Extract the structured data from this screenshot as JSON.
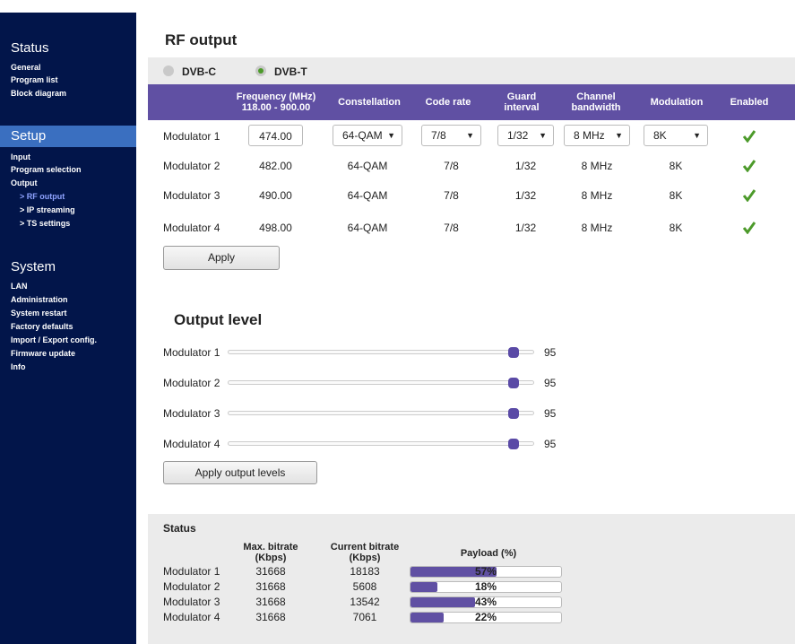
{
  "sidebar": {
    "sections": [
      {
        "title": "Status",
        "items": [
          "General",
          "Program list",
          "Block diagram"
        ]
      },
      {
        "title": "Setup",
        "items": [
          "Input",
          "Program selection",
          "Output"
        ],
        "subitems": [
          "> RF output",
          "> IP streaming",
          "> TS settings"
        ]
      },
      {
        "title": "System",
        "items": [
          "LAN",
          "Administration",
          "System restart",
          "Factory defaults",
          "Import / Export config.",
          "Firmware update",
          "Info"
        ]
      }
    ]
  },
  "rf": {
    "title": "RF output",
    "standards": [
      "DVB-C",
      "DVB-T"
    ],
    "selected_standard": "DVB-T",
    "headers": {
      "frequency": "Frequency (MHz)",
      "frequency_range": "118.00 - 900.00",
      "constellation": "Constellation",
      "code_rate": "Code rate",
      "guard": "Guard interval",
      "guard_l1": "Guard",
      "guard_l2": "interval",
      "bandwidth_l1": "Channel",
      "bandwidth_l2": "bandwidth",
      "modulation": "Modulation",
      "enabled": "Enabled"
    },
    "rows": [
      {
        "name": "Modulator 1",
        "frequency": "474.00",
        "constellation": "64-QAM",
        "code_rate": "7/8",
        "guard": "1/32",
        "bandwidth": "8 MHz",
        "modulation": "8K",
        "enabled": true
      },
      {
        "name": "Modulator 2",
        "frequency": "482.00",
        "constellation": "64-QAM",
        "code_rate": "7/8",
        "guard": "1/32",
        "bandwidth": "8 MHz",
        "modulation": "8K",
        "enabled": true
      },
      {
        "name": "Modulator 3",
        "frequency": "490.00",
        "constellation": "64-QAM",
        "code_rate": "7/8",
        "guard": "1/32",
        "bandwidth": "8 MHz",
        "modulation": "8K",
        "enabled": true
      },
      {
        "name": "Modulator 4",
        "frequency": "498.00",
        "constellation": "64-QAM",
        "code_rate": "7/8",
        "guard": "1/32",
        "bandwidth": "8 MHz",
        "modulation": "8K",
        "enabled": true
      }
    ],
    "apply_label": "Apply"
  },
  "output_level": {
    "title": "Output level",
    "rows": [
      {
        "name": "Modulator 1",
        "value": "95"
      },
      {
        "name": "Modulator 2",
        "value": "95"
      },
      {
        "name": "Modulator 3",
        "value": "95"
      },
      {
        "name": "Modulator 4",
        "value": "95"
      }
    ],
    "apply_label": "Apply output levels"
  },
  "status": {
    "title": "Status",
    "headers": {
      "max_l1": "Max. bitrate",
      "max_l2": "(Kbps)",
      "cur_l1": "Current bitrate",
      "cur_l2": "(Kbps)",
      "payload": "Payload (%)"
    },
    "rows": [
      {
        "name": "Modulator 1",
        "max": "31668",
        "current": "18183",
        "payload_label": "57%",
        "payload_pct": 57
      },
      {
        "name": "Modulator 2",
        "max": "31668",
        "current": "5608",
        "payload_label": "18%",
        "payload_pct": 18
      },
      {
        "name": "Modulator 3",
        "max": "31668",
        "current": "13542",
        "payload_label": "43%",
        "payload_pct": 43
      },
      {
        "name": "Modulator 4",
        "max": "31668",
        "current": "7061",
        "payload_label": "22%",
        "payload_pct": 22
      }
    ]
  },
  "colors": {
    "sidebar": "#02154a",
    "setup_highlight": "#3a6fc0",
    "accent": "#6050a3",
    "active_link": "#8fa3ff",
    "check": "#4c9a2a"
  }
}
